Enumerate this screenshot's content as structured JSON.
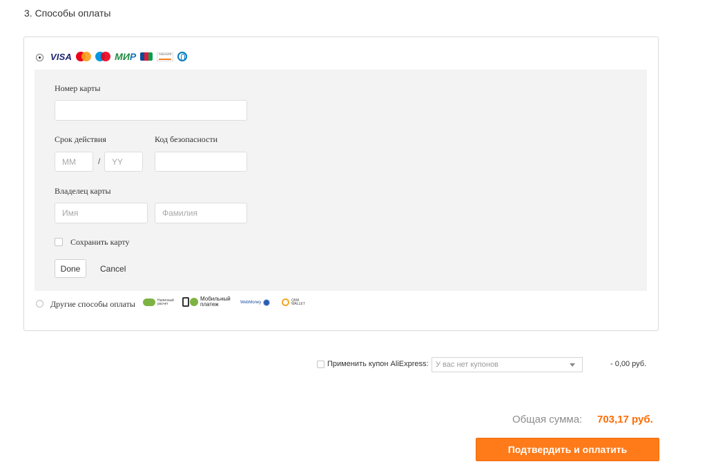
{
  "section": {
    "title": "3. Способы оплаты"
  },
  "card_option": {
    "selected": true,
    "logos": [
      "visa",
      "maestro",
      "mastercard",
      "mir",
      "jcb",
      "discover",
      "diners"
    ],
    "logo_text": {
      "visa": "VISA",
      "mir_green": "МИ",
      "mir_blue": "Р",
      "discover": "DISCOVER"
    }
  },
  "card_form": {
    "card_number_label": "Номер карты",
    "card_number_value": "",
    "expiry_label": "Срок действия",
    "expiry_month_placeholder": "MM",
    "expiry_separator": "/",
    "expiry_year_placeholder": "YY",
    "cvc_label": "Код безопасности",
    "cvc_value": "",
    "holder_label": "Владелец карты",
    "first_name_placeholder": "Имя",
    "last_name_placeholder": "Фамилия",
    "save_card_label": "Сохранить карту",
    "save_card_checked": false,
    "done_label": "Done",
    "cancel_label": "Cancel"
  },
  "other_option": {
    "label": "Другие способы оплаты",
    "selected": false,
    "methods": {
      "cash": {
        "line1": "Наличный",
        "line2": "расчет"
      },
      "mobile": {
        "line1": "Мобильный",
        "line2": "платеж"
      },
      "webmoney": "WebMoney",
      "qiwi": {
        "line1": "QIWI",
        "line2": "WALLET"
      }
    }
  },
  "coupon": {
    "label": "Применить купон AliExpress:",
    "checked": false,
    "select_value": "У вас нет купонов",
    "amount": "- 0,00 руб."
  },
  "total": {
    "label": "Общая сумма:",
    "value": "703,17 руб."
  },
  "confirm_button": {
    "label": "Подтвердить и оплатить"
  },
  "colors": {
    "accent": "#ff7b1a",
    "total_value": "#ff6a00",
    "visa": "#1a1f71",
    "mir_green": "#1f8a3e",
    "mir_blue": "#0f75bc"
  }
}
